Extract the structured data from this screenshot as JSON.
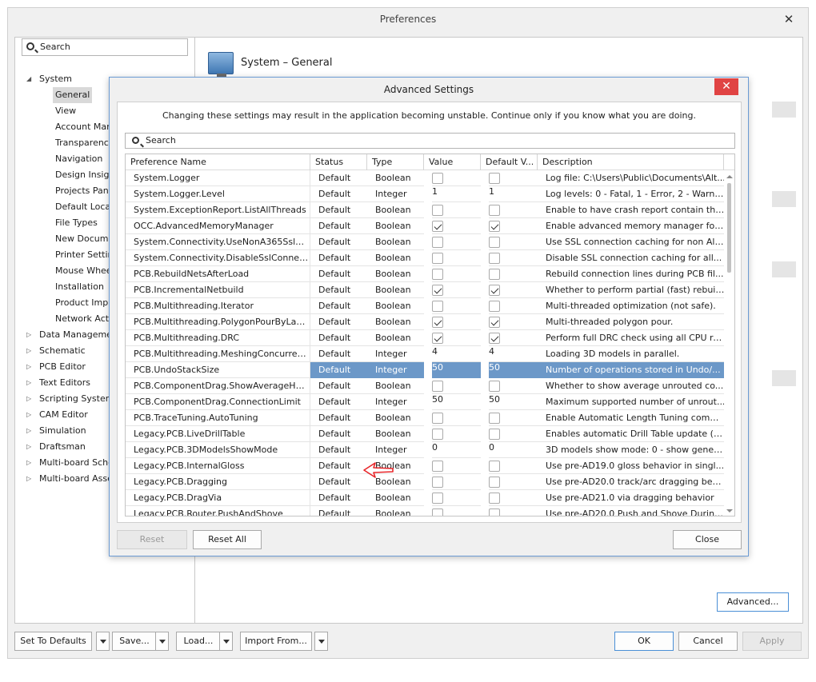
{
  "preferences": {
    "title": "Preferences",
    "close_glyph": "✕",
    "search_placeholder": "Search",
    "tree": [
      {
        "label": "System",
        "level": 0,
        "toggle": "◢",
        "selected": false
      },
      {
        "label": "General",
        "level": 1,
        "toggle": "",
        "selected": true
      },
      {
        "label": "View",
        "level": 1,
        "toggle": "",
        "selected": false
      },
      {
        "label": "Account Man",
        "level": 1,
        "toggle": "",
        "selected": false
      },
      {
        "label": "Transparency",
        "level": 1,
        "toggle": "",
        "selected": false
      },
      {
        "label": "Navigation",
        "level": 1,
        "toggle": "",
        "selected": false
      },
      {
        "label": "Design Insigh",
        "level": 1,
        "toggle": "",
        "selected": false
      },
      {
        "label": "Projects Pane",
        "level": 1,
        "toggle": "",
        "selected": false
      },
      {
        "label": "Default Locat",
        "level": 1,
        "toggle": "",
        "selected": false
      },
      {
        "label": "File Types",
        "level": 1,
        "toggle": "",
        "selected": false
      },
      {
        "label": "New Docume",
        "level": 1,
        "toggle": "",
        "selected": false
      },
      {
        "label": "Printer Setting",
        "level": 1,
        "toggle": "",
        "selected": false
      },
      {
        "label": "Mouse Whee",
        "level": 1,
        "toggle": "",
        "selected": false
      },
      {
        "label": "Installation",
        "level": 1,
        "toggle": "",
        "selected": false
      },
      {
        "label": "Product Impro",
        "level": 1,
        "toggle": "",
        "selected": false
      },
      {
        "label": "Network Activ",
        "level": 1,
        "toggle": "",
        "selected": false
      },
      {
        "label": "Data Managemer",
        "level": 0,
        "toggle": "▷",
        "selected": false
      },
      {
        "label": "Schematic",
        "level": 0,
        "toggle": "▷",
        "selected": false
      },
      {
        "label": "PCB Editor",
        "level": 0,
        "toggle": "▷",
        "selected": false
      },
      {
        "label": "Text Editors",
        "level": 0,
        "toggle": "▷",
        "selected": false
      },
      {
        "label": "Scripting System",
        "level": 0,
        "toggle": "▷",
        "selected": false
      },
      {
        "label": "CAM Editor",
        "level": 0,
        "toggle": "▷",
        "selected": false
      },
      {
        "label": "Simulation",
        "level": 0,
        "toggle": "▷",
        "selected": false
      },
      {
        "label": "Draftsman",
        "level": 0,
        "toggle": "▷",
        "selected": false
      },
      {
        "label": "Multi-board Sche",
        "level": 0,
        "toggle": "▷",
        "selected": false
      },
      {
        "label": "Multi-board Asse",
        "level": 0,
        "toggle": "▷",
        "selected": false
      }
    ],
    "page_title": "System – General",
    "advanced_button": "Advanced...",
    "set_defaults": "Set To Defaults",
    "save": "Save...",
    "load": "Load...",
    "import_from": "Import From...",
    "ok": "OK",
    "cancel": "Cancel",
    "apply": "Apply"
  },
  "advanced": {
    "title": "Advanced Settings",
    "close_glyph": "✕",
    "warning": "Changing these settings may result in the application becoming unstable. Continue only if you know what you are doing.",
    "search_placeholder": "Search",
    "columns": [
      "Preference Name",
      "Status",
      "Type",
      "Value",
      "Default V...",
      "Description"
    ],
    "rows": [
      {
        "name": "System.Logger",
        "status": "Default",
        "type": "Boolean",
        "value": false,
        "default": false,
        "description": "Log file: C:\\Users\\Public\\Documents\\Alt..."
      },
      {
        "name": "System.Logger.Level",
        "status": "Default",
        "type": "Integer",
        "value": "1",
        "default": "1",
        "description": "Log levels: 0 - Fatal, 1 - Error, 2 - Warn,..."
      },
      {
        "name": "System.ExceptionReport.ListAllThreads",
        "status": "Default",
        "type": "Boolean",
        "value": false,
        "default": false,
        "description": "Enable to have crash report contain the..."
      },
      {
        "name": "OCC.AdvancedMemoryManager",
        "status": "Default",
        "type": "Boolean",
        "value": true,
        "default": true,
        "description": "Enable advanced memory manager for..."
      },
      {
        "name": "System.Connectivity.UseNonA365SslCo...",
        "status": "Default",
        "type": "Boolean",
        "value": false,
        "default": false,
        "description": "Use SSL connection caching for non Alt..."
      },
      {
        "name": "System.Connectivity.DisableSslConnecti...",
        "status": "Default",
        "type": "Boolean",
        "value": false,
        "default": false,
        "description": "Disable SSL connection caching for all..."
      },
      {
        "name": "PCB.RebuildNetsAfterLoad",
        "status": "Default",
        "type": "Boolean",
        "value": false,
        "default": false,
        "description": "Rebuild connection lines during PCB fil..."
      },
      {
        "name": "PCB.IncrementalNetbuild",
        "status": "Default",
        "type": "Boolean",
        "value": true,
        "default": true,
        "description": "Whether to perform partial (fast) rebuil..."
      },
      {
        "name": "PCB.Multithreading.Iterator",
        "status": "Default",
        "type": "Boolean",
        "value": false,
        "default": false,
        "description": "Multi-threaded optimization (not safe)."
      },
      {
        "name": "PCB.Multithreading.PolygonPourByLayer",
        "status": "Default",
        "type": "Boolean",
        "value": true,
        "default": true,
        "description": "Multi-threaded polygon pour."
      },
      {
        "name": "PCB.Multithreading.DRC",
        "status": "Default",
        "type": "Boolean",
        "value": true,
        "default": true,
        "description": "Perform full DRC check using all CPU re..."
      },
      {
        "name": "PCB.Multithreading.MeshingConcurrency",
        "status": "Default",
        "type": "Integer",
        "value": "4",
        "default": "4",
        "description": "Loading 3D models in parallel."
      },
      {
        "name": "PCB.UndoStackSize",
        "status": "Default",
        "type": "Integer",
        "value": "50",
        "default": "50",
        "description": "Number of operations stored in Undo/...",
        "selected": true
      },
      {
        "name": "PCB.ComponentDrag.ShowAverageHel...",
        "status": "Default",
        "type": "Boolean",
        "value": false,
        "default": false,
        "description": "Whether to show average unrouted co..."
      },
      {
        "name": "PCB.ComponentDrag.ConnectionLimit",
        "status": "Default",
        "type": "Integer",
        "value": "50",
        "default": "50",
        "description": "Maximum supported number of unrout..."
      },
      {
        "name": "PCB.TraceTuning.AutoTuning",
        "status": "Default",
        "type": "Boolean",
        "value": false,
        "default": false,
        "description": "Enable Automatic Length Tuning comm..."
      },
      {
        "name": "Legacy.PCB.LiveDrillTable",
        "status": "Default",
        "type": "Boolean",
        "value": false,
        "default": false,
        "description": "Enables automatic Drill Table update (p..."
      },
      {
        "name": "Legacy.PCB.3DModelsShowMode",
        "status": "Default",
        "type": "Integer",
        "value": "0",
        "default": "0",
        "description": "3D models show mode: 0 - show generi..."
      },
      {
        "name": "Legacy.PCB.InternalGloss",
        "status": "Default",
        "type": "Boolean",
        "value": false,
        "default": false,
        "description": "Use pre-AD19.0 gloss behavior in singl..."
      },
      {
        "name": "Legacy.PCB.Dragging",
        "status": "Default",
        "type": "Boolean",
        "value": false,
        "default": false,
        "description": "Use pre-AD20.0 track/arc dragging beh..."
      },
      {
        "name": "Legacy.PCB.DragVia",
        "status": "Default",
        "type": "Boolean",
        "value": false,
        "default": false,
        "description": "Use pre-AD21.0 via dragging behavior"
      },
      {
        "name": "Legacy.PCB.Router.PushAndShove",
        "status": "Default",
        "type": "Boolean",
        "value": false,
        "default": false,
        "description": "Use pre-AD20.0 Push and Shove During..."
      }
    ],
    "reset": "Reset",
    "reset_all": "Reset All",
    "close": "Close",
    "annotation_color": "#e8262a",
    "selection_color": "#6c98c8"
  }
}
